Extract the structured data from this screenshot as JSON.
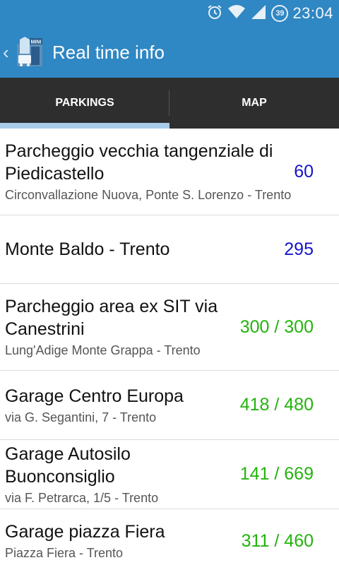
{
  "status_bar": {
    "time": "23:04",
    "battery_level": "39",
    "icons": [
      "alarm-icon",
      "wifi-icon",
      "signal-icon",
      "battery-icon"
    ]
  },
  "action_bar": {
    "title": "Real time info",
    "logo_badge": "MINI"
  },
  "tabs": [
    {
      "label": "PARKINGS",
      "selected": true
    },
    {
      "label": "MAP",
      "selected": false
    }
  ],
  "parkings": [
    {
      "name": "Parcheggio vecchia tangenziale di Piedicastello",
      "address": "Circonvallazione Nuova, Ponte S. Lorenzo - Trento",
      "count": "60",
      "status_color": "#1414c8"
    },
    {
      "name": "Monte Baldo - Trento",
      "address": "",
      "count": "295",
      "status_color": "#1414c8"
    },
    {
      "name": "Parcheggio area ex SIT via Canestrini",
      "address": "Lung'Adige Monte Grappa - Trento",
      "count": "300 / 300",
      "status_color": "#22b40c"
    },
    {
      "name": "Garage Centro Europa",
      "address": "via G. Segantini, 7 - Trento",
      "count": "418 / 480",
      "status_color": "#22b40c"
    },
    {
      "name": "Garage Autosilo Buonconsiglio",
      "address": "via F. Petrarca, 1/5 - Trento",
      "count": "141 / 669",
      "status_color": "#22b40c"
    },
    {
      "name": "Garage piazza Fiera",
      "address": "Piazza Fiera - Trento",
      "count": "311 / 460",
      "status_color": "#22b40c"
    }
  ],
  "colors": {
    "primary": "#2f87c3",
    "tab_background": "#2e2e2e",
    "tab_indicator": "#a9cde9"
  }
}
